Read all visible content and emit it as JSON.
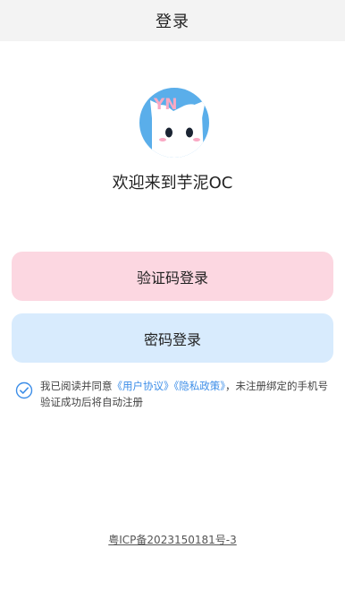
{
  "header": {
    "title": "登录"
  },
  "welcome_text": "欢迎来到芋泥OC",
  "logo": {
    "letters": "YN",
    "icon": "cat-mascot-icon",
    "bg_color": "#5aaeea",
    "accent_color": "#f9a9c4"
  },
  "buttons": {
    "sms_login": "验证码登录",
    "password_login": "密码登录"
  },
  "agreement": {
    "checked": true,
    "prefix": "我已阅读并同意",
    "user_agreement": "《用户协议》",
    "privacy_policy": "《隐私政策》",
    "suffix": "，未注册绑定的手机号验证成功后将自动注册"
  },
  "footer": {
    "icp": "粤ICP备2023150181号-3"
  },
  "colors": {
    "pink_button": "#fcd7e1",
    "blue_button": "#d8ebfd",
    "link": "#3d8ee8",
    "check": "#3d8ee8"
  }
}
